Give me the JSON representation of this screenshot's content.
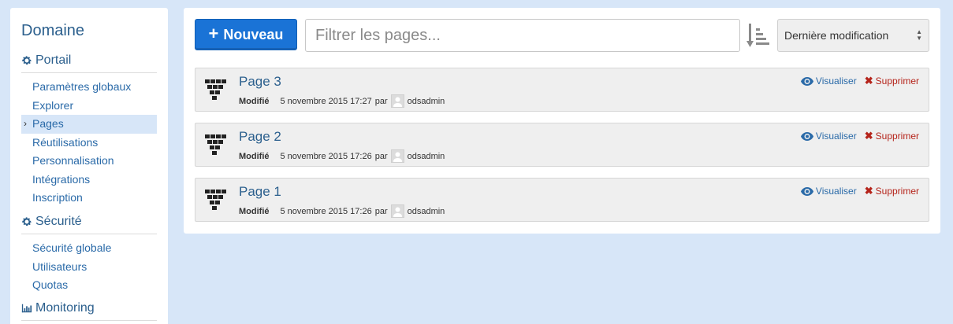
{
  "sidebar": {
    "title": "Domaine",
    "sections": [
      {
        "label": "Portail",
        "icon": "gear-icon",
        "items": [
          {
            "label": "Paramètres globaux",
            "active": false
          },
          {
            "label": "Explorer",
            "active": false
          },
          {
            "label": "Pages",
            "active": true
          },
          {
            "label": "Réutilisations",
            "active": false
          },
          {
            "label": "Personnalisation",
            "active": false
          },
          {
            "label": "Intégrations",
            "active": false
          },
          {
            "label": "Inscription",
            "active": false
          }
        ]
      },
      {
        "label": "Sécurité",
        "icon": "gear-icon",
        "items": [
          {
            "label": "Sécurité globale",
            "active": false
          },
          {
            "label": "Utilisateurs",
            "active": false
          },
          {
            "label": "Quotas",
            "active": false
          }
        ]
      },
      {
        "label": "Monitoring",
        "icon": "bar-chart-icon",
        "items": []
      }
    ]
  },
  "toolbar": {
    "new_label": "Nouveau",
    "filter_placeholder": "Filtrer les pages...",
    "sort_selected": "Dernière modification"
  },
  "pages": [
    {
      "title": "Page 3",
      "modified_label": "Modifié",
      "date": "5 novembre 2015 17:27",
      "by": "par",
      "user": "odsadmin",
      "view_label": "Visualiser",
      "delete_label": "Supprimer"
    },
    {
      "title": "Page 2",
      "modified_label": "Modifié",
      "date": "5 novembre 2015 17:26",
      "by": "par",
      "user": "odsadmin",
      "view_label": "Visualiser",
      "delete_label": "Supprimer"
    },
    {
      "title": "Page 1",
      "modified_label": "Modifié",
      "date": "5 novembre 2015 17:26",
      "by": "par",
      "user": "odsadmin",
      "view_label": "Visualiser",
      "delete_label": "Supprimer"
    }
  ],
  "colors": {
    "background": "#d7e6f8",
    "primary": "#1a73d6",
    "link": "#2a6aa8",
    "danger": "#b5241b"
  }
}
